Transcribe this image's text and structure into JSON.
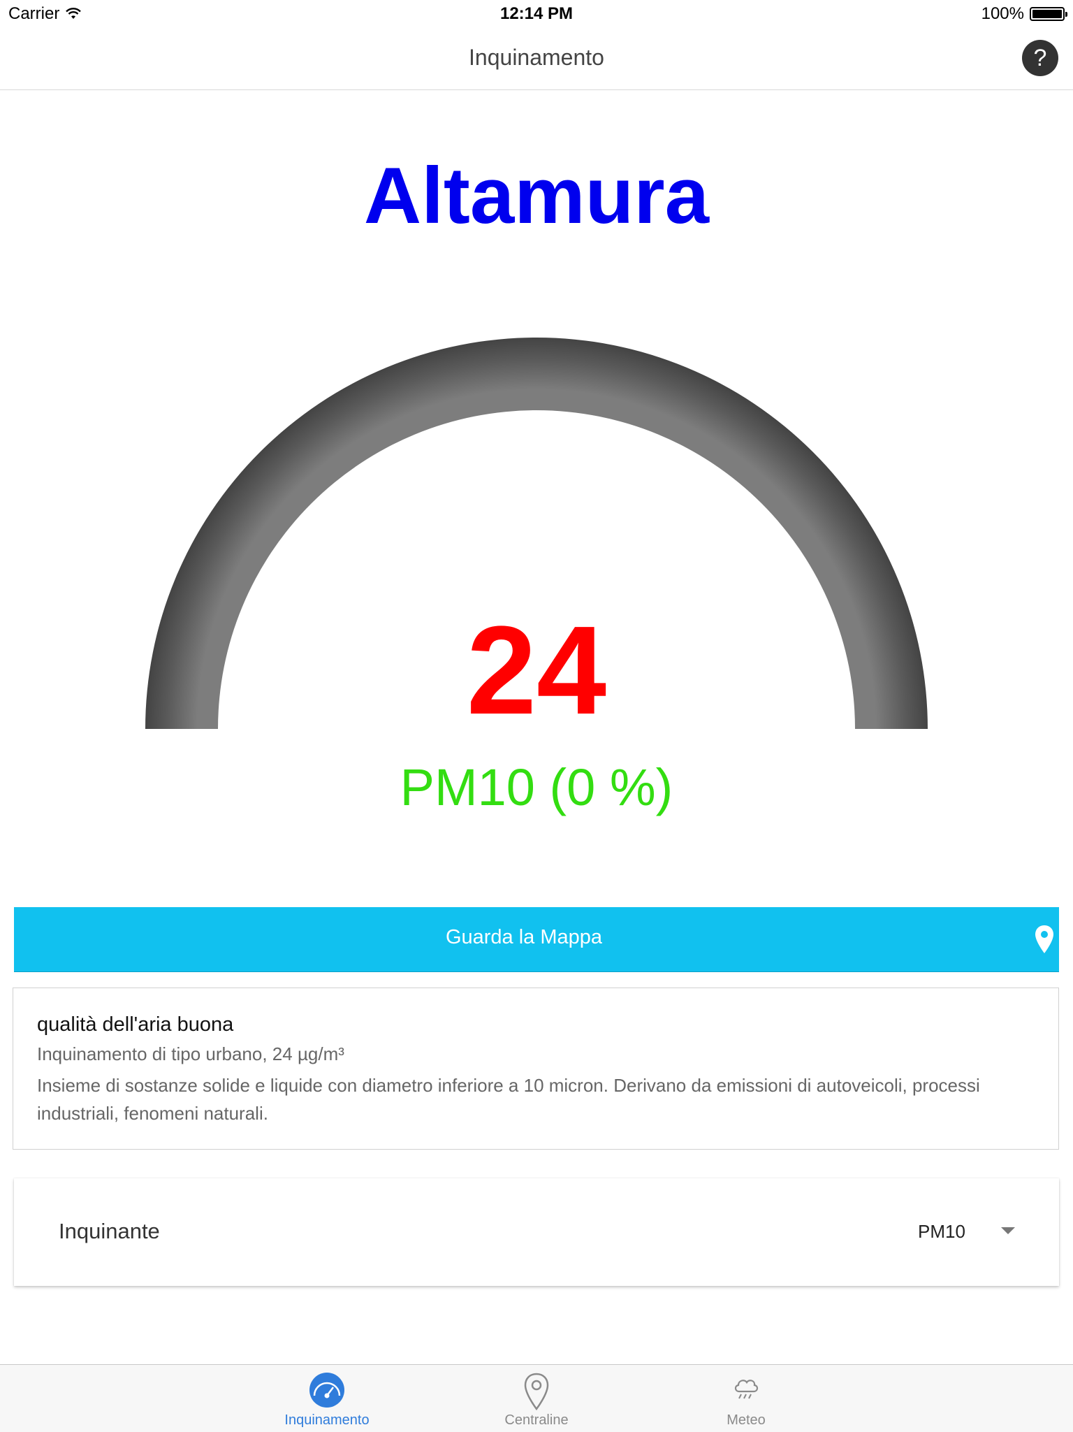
{
  "status_bar": {
    "carrier": "Carrier",
    "time": "12:14 PM",
    "battery": "100%"
  },
  "nav": {
    "title": "Inquinamento",
    "help_label": "?"
  },
  "city": "Altamura",
  "gauge": {
    "value": "24",
    "subtitle": "PM10 (0 %)",
    "level_fraction": 0
  },
  "map_button": {
    "label": "Guarda la Mappa",
    "icon": "location-pin-icon"
  },
  "info": {
    "title": "qualità dell'aria buona",
    "subtitle": "Inquinamento di tipo urbano, 24 µg/m³",
    "description": "Insieme di sostanze solide e liquide con diametro inferiore a 10 micron. Derivano da emissioni di autoveicoli, processi industriali, fenomeni naturali."
  },
  "selector": {
    "label": "Inquinante",
    "value": "PM10"
  },
  "tabs": [
    {
      "label": "Inquinamento",
      "icon": "speedometer-icon",
      "active": true
    },
    {
      "label": "Centraline",
      "icon": "location-pin-icon",
      "active": false
    },
    {
      "label": "Meteo",
      "icon": "rain-cloud-icon",
      "active": false
    }
  ],
  "colors": {
    "city": "#0000ee",
    "value": "#ff0000",
    "subtitle": "#33dd11",
    "map_button": "#11c1ef",
    "tab_active": "#2f7cdb",
    "tab_inactive": "#8a8a8a"
  }
}
